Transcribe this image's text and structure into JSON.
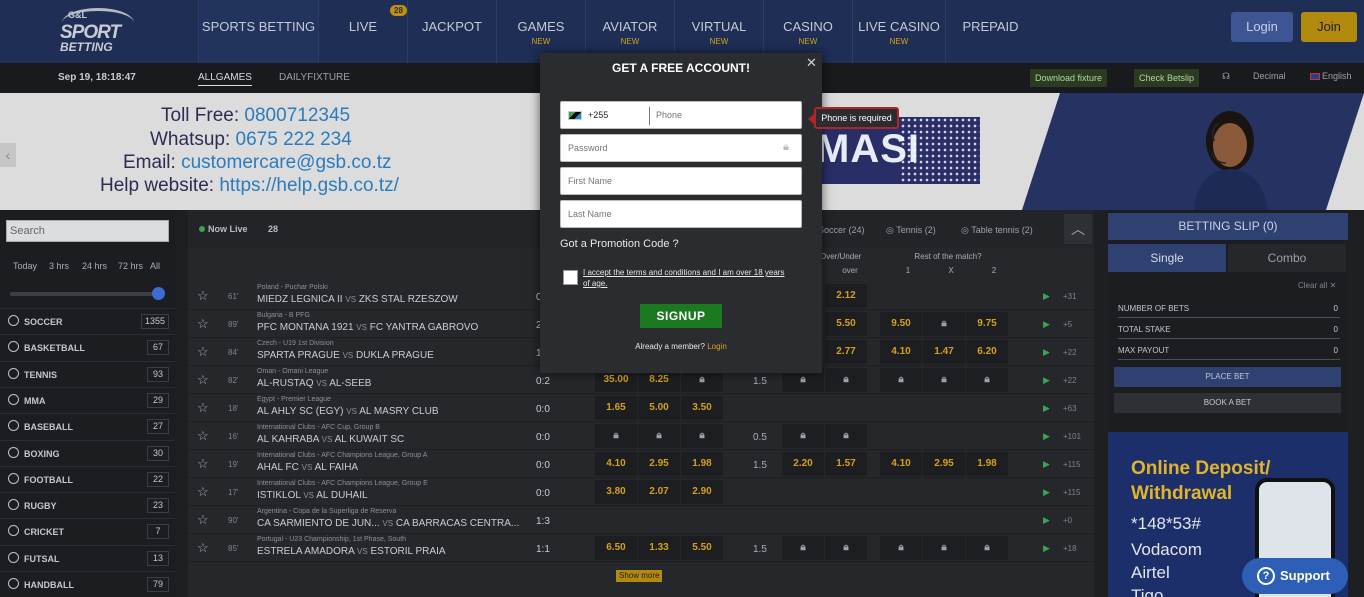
{
  "logo": {
    "top": "G&L",
    "middle": "SPORT",
    "bottom": "BETTING"
  },
  "nav": [
    {
      "label": "SPORTS BETTING",
      "sub": "",
      "badge": ""
    },
    {
      "label": "LIVE",
      "sub": "",
      "badge": "28"
    },
    {
      "label": "JACKPOT",
      "sub": "",
      "badge": ""
    },
    {
      "label": "GAMES",
      "sub": "NEW",
      "badge": ""
    },
    {
      "label": "AVIATOR",
      "sub": "NEW",
      "badge": ""
    },
    {
      "label": "VIRTUAL",
      "sub": "NEW",
      "badge": ""
    },
    {
      "label": "CASINO",
      "sub": "NEW",
      "badge": ""
    },
    {
      "label": "LIVE CASINO",
      "sub": "NEW",
      "badge": ""
    },
    {
      "label": "PREPAID",
      "sub": "",
      "badge": ""
    }
  ],
  "auth": {
    "login": "Login",
    "join": "Join"
  },
  "subbar": {
    "datetime": "Sep 19, 18:18:47",
    "tab_all": "ALLGAMES",
    "tab_daily": "DAILYFIXTURE",
    "download": "Download fixture",
    "check": "Check Betslip",
    "odds_format": "Decimal",
    "language": "English"
  },
  "banner": {
    "toll_label": "Toll Free: ",
    "toll": "0800712345",
    "whatsapp_label": "Whatsup: ",
    "whatsapp": "0675 222 234",
    "email_label": "Email: ",
    "email": "customercare@gsb.co.tz",
    "help_label": "Help website: ",
    "help": "https://help.gsb.co.tz/",
    "promo_text": "MASI"
  },
  "sidebar": {
    "search_placeholder": "Search",
    "time_filters": [
      "Today",
      "3 hrs",
      "24 hrs",
      "72 hrs",
      "All"
    ],
    "sports": [
      {
        "name": "SOCCER",
        "count": "1355"
      },
      {
        "name": "BASKETBALL",
        "count": "67"
      },
      {
        "name": "TENNIS",
        "count": "93"
      },
      {
        "name": "MMA",
        "count": "29"
      },
      {
        "name": "BASEBALL",
        "count": "27"
      },
      {
        "name": "BOXING",
        "count": "30"
      },
      {
        "name": "FOOTBALL",
        "count": "22"
      },
      {
        "name": "RUGBY",
        "count": "23"
      },
      {
        "name": "CRICKET",
        "count": "7"
      },
      {
        "name": "FUTSAL",
        "count": "13"
      },
      {
        "name": "HANDBALL",
        "count": "79"
      }
    ]
  },
  "live": {
    "title": "Now Live",
    "count": "28",
    "sport_tabs": [
      "Soccer (24)",
      "Tennis (2)",
      "Table tennis (2)"
    ],
    "col_over_under": "Over/Under",
    "col_over": "over",
    "col_rest": "Rest of the match?",
    "col_rest_opts": [
      "1",
      "X",
      "2"
    ],
    "show_more": "Show more",
    "matches": [
      {
        "min": "61'",
        "league": "Poland - Puchar Polski",
        "home": "MIEDZ LEGNICA II",
        "away": "ZKS STAL RZESZOW",
        "score": "0",
        "odds": [
          "",
          "",
          ""
        ],
        "hc": "",
        "ou": [
          "",
          "2.12"
        ],
        "rest": [
          "",
          "",
          ""
        ],
        "more": "+31"
      },
      {
        "min": "89'",
        "league": "Bulgaria - B PFG",
        "home": "PFC MONTANA 1921",
        "away": "FC YANTRA GABROVO",
        "score": "2",
        "odds": [
          "",
          "",
          ""
        ],
        "hc": "",
        "ou": [
          "",
          "5.50"
        ],
        "rest": [
          "9.50",
          "L",
          "9.75"
        ],
        "more": "+5"
      },
      {
        "min": "84'",
        "league": "Czech - U19 1st Division",
        "home": "SPARTA PRAGUE",
        "away": "DUKLA PRAGUE",
        "score": "1",
        "odds": [
          "",
          "",
          ""
        ],
        "hc": "",
        "ou": [
          "",
          "2.77"
        ],
        "rest": [
          "4.10",
          "1.47",
          "6.20"
        ],
        "more": "+22"
      },
      {
        "min": "82'",
        "league": "Oman - Omani League",
        "home": "AL-RUSTAQ",
        "away": "AL-SEEB",
        "score": "0:2",
        "odds": [
          "35.00",
          "8.25",
          "L"
        ],
        "hc": "1.5",
        "ou": [
          "L",
          "L"
        ],
        "rest": [
          "L",
          "L",
          "L"
        ],
        "more": "+22"
      },
      {
        "min": "18'",
        "league": "Egypt - Premier League",
        "home": "AL AHLY SC (EGY)",
        "away": "AL MASRY CLUB",
        "score": "0:0",
        "odds": [
          "1.65",
          "5.00",
          "3.50"
        ],
        "hc": "",
        "ou": [
          "",
          ""
        ],
        "rest": [
          "",
          "",
          ""
        ],
        "more": "+63"
      },
      {
        "min": "16'",
        "league": "International Clubs - AFC Cup, Group B",
        "home": "AL KAHRABA",
        "away": "AL KUWAIT SC",
        "score": "0:0",
        "odds": [
          "L",
          "L",
          "L"
        ],
        "hc": "0.5",
        "ou": [
          "L",
          "L"
        ],
        "rest": [
          "",
          "",
          ""
        ],
        "more": "+101"
      },
      {
        "min": "19'",
        "league": "International Clubs - AFC Champions League, Group A",
        "home": "AHAL FC",
        "away": "AL FAIHA",
        "score": "0:0",
        "odds": [
          "4.10",
          "2.95",
          "1.98"
        ],
        "hc": "1.5",
        "ou": [
          "2.20",
          "1.57"
        ],
        "rest": [
          "4.10",
          "2.95",
          "1.98"
        ],
        "more": "+115"
      },
      {
        "min": "17'",
        "league": "International Clubs - AFC Champions League, Group E",
        "home": "ISTIKLOL",
        "away": "AL DUHAIL",
        "score": "0:0",
        "odds": [
          "3.80",
          "2.07",
          "2.90"
        ],
        "hc": "",
        "ou": [
          "",
          ""
        ],
        "rest": [
          "",
          "",
          ""
        ],
        "more": "+115"
      },
      {
        "min": "90'",
        "league": "Argentina - Copa de la Superliga de Reserva",
        "home": "CA SARMIENTO DE JUN...",
        "away": "CA BARRACAS CENTRA...",
        "score": "1:3",
        "odds": [
          "",
          "",
          ""
        ],
        "hc": "",
        "ou": [
          "",
          ""
        ],
        "rest": [
          "",
          "",
          ""
        ],
        "more": "+0"
      },
      {
        "min": "85'",
        "league": "Portugal - U23 Championship, 1st Phase, South",
        "home": "ESTRELA AMADORA",
        "away": "ESTORIL PRAIA",
        "score": "1:1",
        "odds": [
          "6.50",
          "1.33",
          "5.50"
        ],
        "hc": "1.5",
        "ou": [
          "L",
          "L"
        ],
        "rest": [
          "L",
          "L",
          "L"
        ],
        "more": "+18"
      }
    ]
  },
  "betslip": {
    "title": "BETTING SLIP (0)",
    "single": "Single",
    "combo": "Combo",
    "clear": "Clear all",
    "rows": [
      {
        "k": "NUMBER OF BETS",
        "v": "0"
      },
      {
        "k": "TOTAL STAKE",
        "v": "0"
      },
      {
        "k": "MAX PAYOUT",
        "v": "0"
      }
    ],
    "place": "PLACE BET",
    "book": "BOOK A BET"
  },
  "ad": {
    "h1": "Online Deposit/",
    "h2": "Withdrawal",
    "code": "*148*53#",
    "n1": "Vodacom",
    "n2": "Airtel",
    "n3": "Tigo"
  },
  "support": "Support",
  "modal": {
    "title": "GET A FREE ACCOUNT!",
    "country_code": "+255",
    "phone_placeholder": "Phone",
    "password_placeholder": "Password",
    "first_placeholder": "First Name",
    "last_placeholder": "Last Name",
    "error": "Phone is required",
    "promo": "Got a Promotion Code ?",
    "terms": "I accept the terms and conditions and I am over 18 years of age.",
    "signup": "SIGNUP",
    "member": "Already a member? ",
    "login": "Login"
  },
  "colors": {
    "nav": "#1e2e55",
    "accent": "#d6a419",
    "signup": "#1b7a1f",
    "error": "#b0252b"
  }
}
